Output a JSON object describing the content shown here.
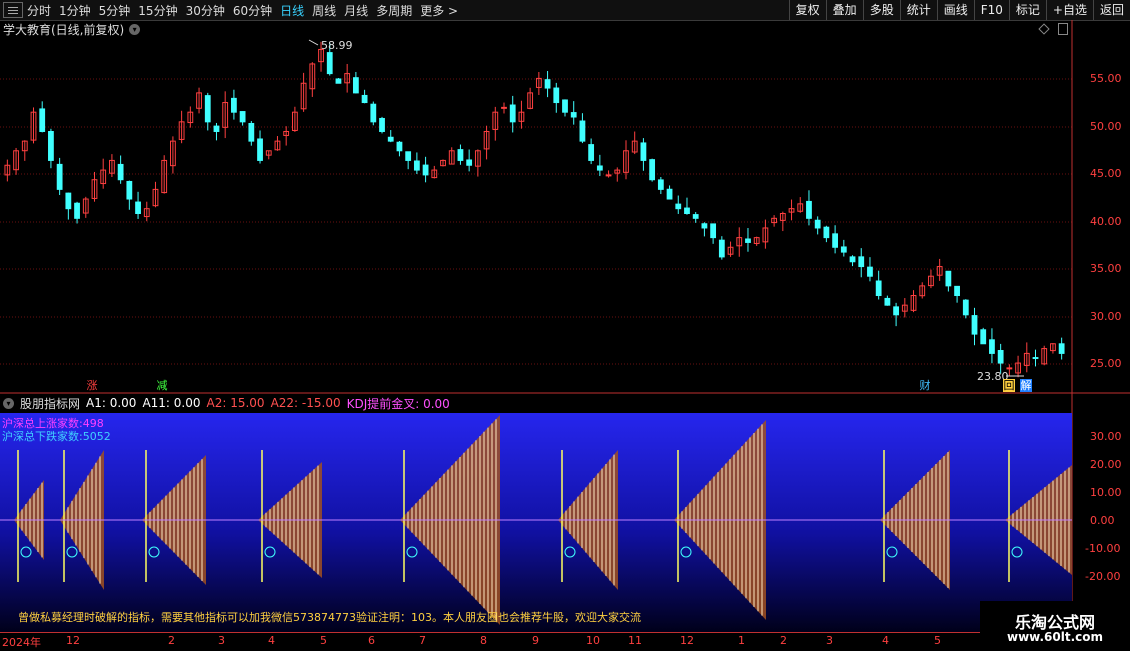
{
  "toolbar": {
    "periods": [
      "分时",
      "1分钟",
      "5分钟",
      "15分钟",
      "30分钟",
      "60分钟",
      "日线",
      "周线",
      "月线",
      "多周期",
      "更多 >"
    ],
    "active_period": "日线",
    "buttons": [
      "复权",
      "叠加",
      "多股",
      "统计",
      "画线",
      "F10",
      "标记",
      "+自选",
      "返回"
    ]
  },
  "main_chart": {
    "title": "学大教育(日线,前复权)",
    "high_label": "58.99",
    "low_label": "23.80",
    "y_ticks": [
      "55.00",
      "50.00",
      "45.00",
      "40.00",
      "35.00",
      "30.00",
      "25.00"
    ],
    "markers": {
      "up": "涨",
      "down": "减",
      "cai": "财",
      "hui": "回",
      "jie": "解"
    }
  },
  "indicator": {
    "name": "股朋指标网",
    "a1": "A1: 0.00",
    "a11": "A11: 0.00",
    "a2": "A2: 15.00",
    "a22": "A22: -15.00",
    "kdj": "KDJ提前金叉: 0.00",
    "count_up": "沪深总上涨家数:498",
    "count_down": "沪深总下跌家数:5052",
    "y_ticks": [
      "30.00",
      "20.00",
      "10.00",
      "0.00",
      "-10.00",
      "-20.00"
    ],
    "note": "曾做私募经理时破解的指标，需要其他指标可以加我微信573874773验证注明：103。本人朋友圈也会推荐牛股，欢迎大家交流"
  },
  "x_axis": [
    "2024年",
    "12",
    "2",
    "3",
    "4",
    "5",
    "6",
    "7",
    "8",
    "9",
    "10",
    "11",
    "12",
    "1",
    "2",
    "3",
    "4",
    "5"
  ],
  "watermark": {
    "title": "乐淘公式网",
    "url": "www.60lt.com"
  },
  "colors": {
    "up": "#ff4040",
    "down": "#40ffff",
    "grid": "#7a1010",
    "axis": "#c03030",
    "bg_top": "#2a2af0",
    "bg_bottom": "#000018"
  },
  "chart_data": {
    "type": "candlestick",
    "y_range": [
      23.0,
      60.0
    ],
    "closes": [
      46.5,
      48,
      49,
      52,
      50,
      47,
      44,
      42,
      41,
      43,
      45,
      46,
      47,
      45,
      43,
      41.5,
      42,
      44,
      47,
      49,
      51,
      52,
      54,
      51,
      50,
      53,
      52,
      51,
      49,
      47,
      48,
      49,
      50,
      52,
      55,
      57,
      58.5,
      56,
      55,
      56,
      54,
      53,
      51,
      50,
      49,
      48,
      47,
      46,
      45.5,
      46,
      47,
      48,
      47,
      46.5,
      48,
      50,
      52,
      52.5,
      51,
      52,
      54,
      55.5,
      54.5,
      53,
      52,
      51.5,
      49,
      47,
      46,
      45.5,
      46,
      48,
      49,
      47,
      45,
      44,
      43,
      42,
      41.5,
      41,
      40,
      39,
      37,
      38,
      39,
      38.5,
      39,
      40,
      41,
      41.5,
      42,
      42.5,
      41,
      40,
      39,
      38,
      37.5,
      36.5,
      36,
      35,
      33,
      32,
      31,
      32,
      33,
      34,
      35,
      36,
      34,
      33,
      31,
      29,
      28,
      27,
      26,
      25.5,
      26,
      27,
      26.5,
      27.5,
      28,
      27
    ]
  }
}
